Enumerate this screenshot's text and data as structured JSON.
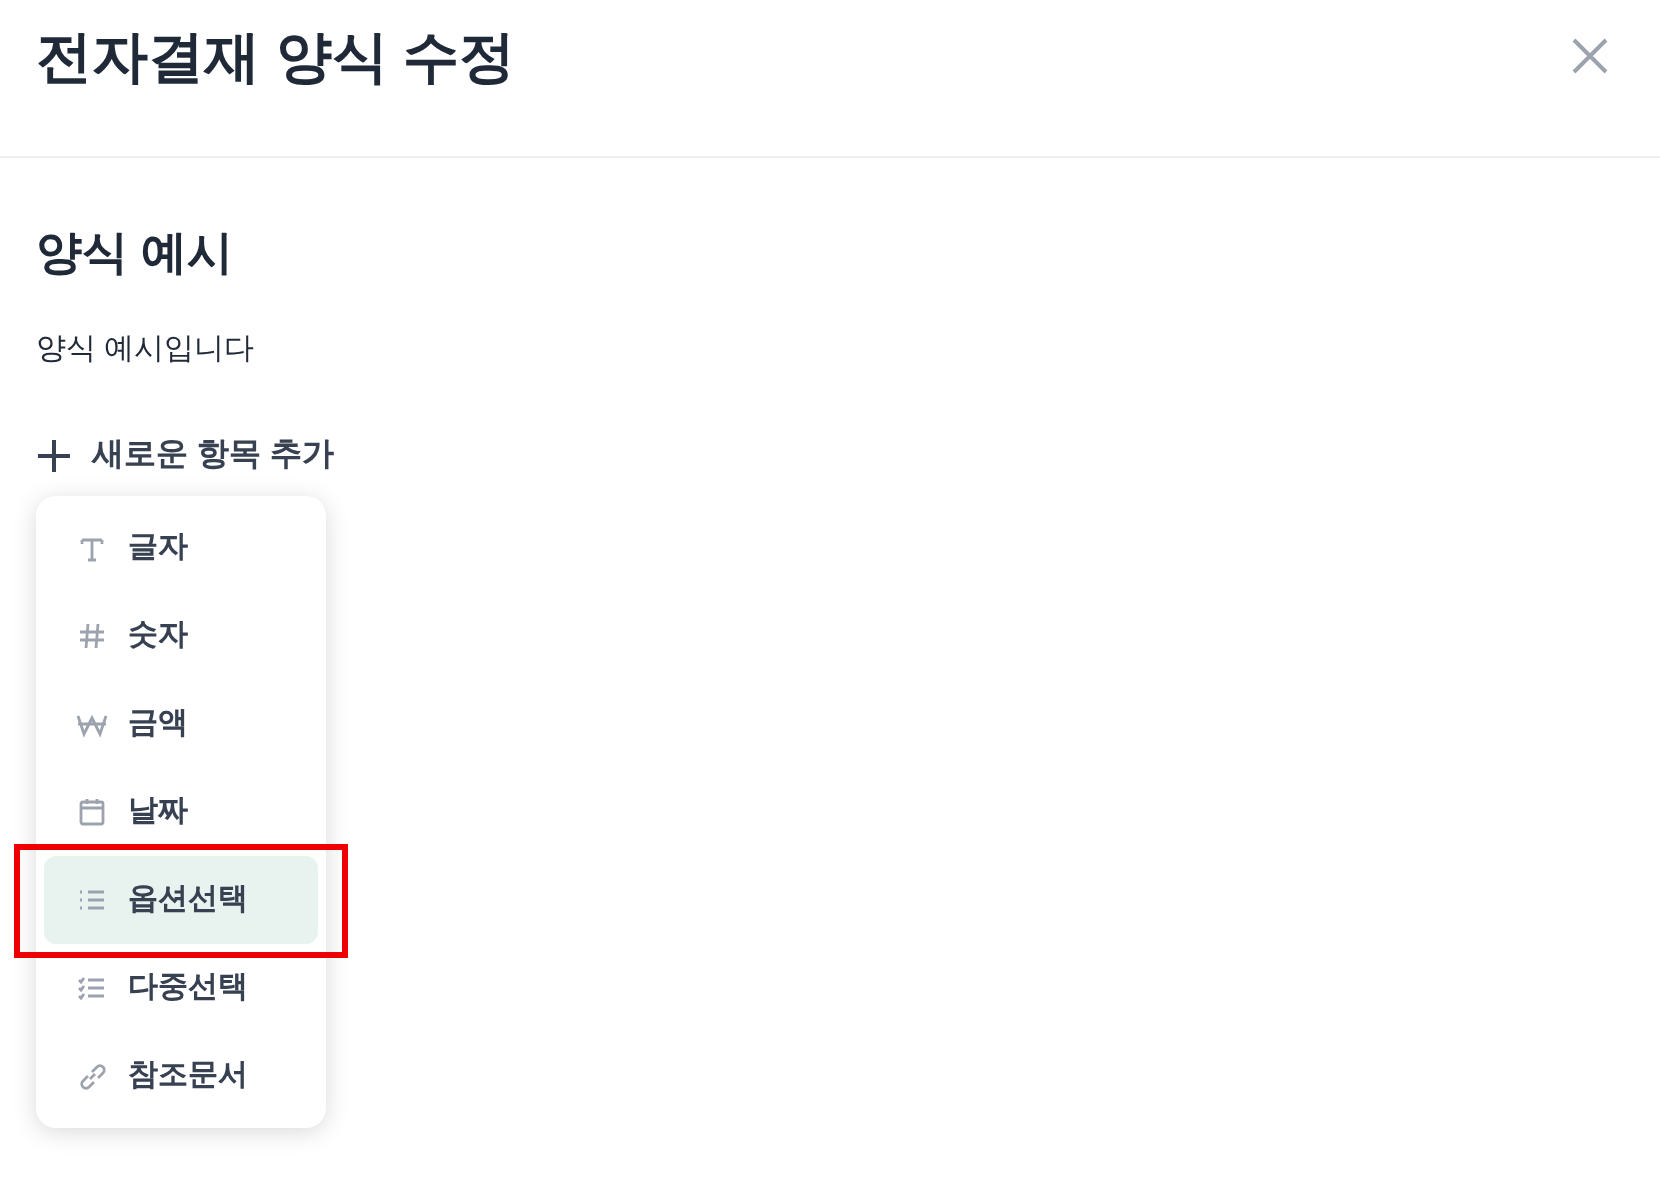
{
  "dialog": {
    "title": "전자결재 양식 수정"
  },
  "form": {
    "title": "양식 예시",
    "description": "양식 예시입니다"
  },
  "add_button": {
    "label": "새로운 항목 추가"
  },
  "menu": {
    "items": [
      {
        "kind": "text",
        "label": "글자",
        "selected": false,
        "annotated": false
      },
      {
        "kind": "number",
        "label": "숫자",
        "selected": false,
        "annotated": false
      },
      {
        "kind": "currency",
        "label": "금액",
        "selected": false,
        "annotated": false
      },
      {
        "kind": "date",
        "label": "날짜",
        "selected": false,
        "annotated": false
      },
      {
        "kind": "option",
        "label": "옵션선택",
        "selected": true,
        "annotated": true
      },
      {
        "kind": "multi",
        "label": "다중선택",
        "selected": false,
        "annotated": false
      },
      {
        "kind": "reference",
        "label": "참조문서",
        "selected": false,
        "annotated": false
      }
    ]
  }
}
